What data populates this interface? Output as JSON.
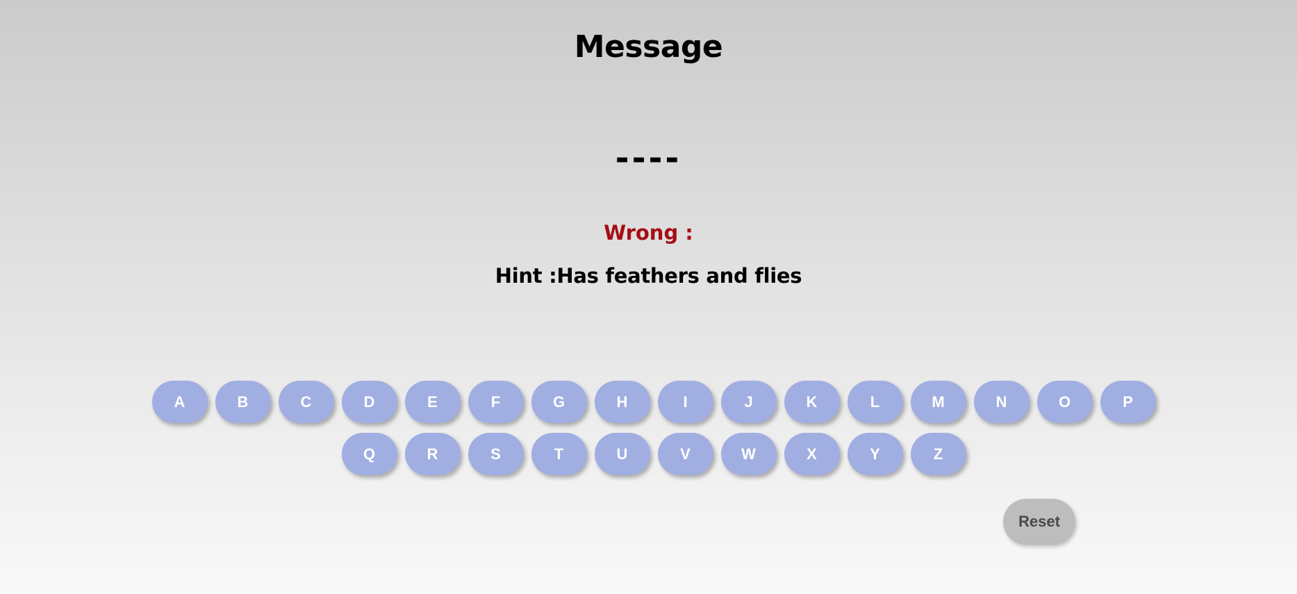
{
  "header": {
    "title": "Message"
  },
  "game": {
    "word_display": "----",
    "wrong_label": "Wrong :",
    "hint_text": "Hint :Has feathers and flies"
  },
  "keyboard": {
    "row1": [
      "A",
      "B",
      "C",
      "D",
      "E",
      "F",
      "G",
      "H",
      "I",
      "J",
      "K",
      "L",
      "M",
      "N",
      "O",
      "P"
    ],
    "row2": [
      "Q",
      "R",
      "S",
      "T",
      "U",
      "V",
      "W",
      "X",
      "Y",
      "Z"
    ]
  },
  "controls": {
    "reset_label": "Reset"
  },
  "colors": {
    "key_bg": "#a1aee1",
    "key_text": "#ffffff",
    "wrong_text": "#a50e14",
    "reset_bg": "#bdbdbd"
  }
}
